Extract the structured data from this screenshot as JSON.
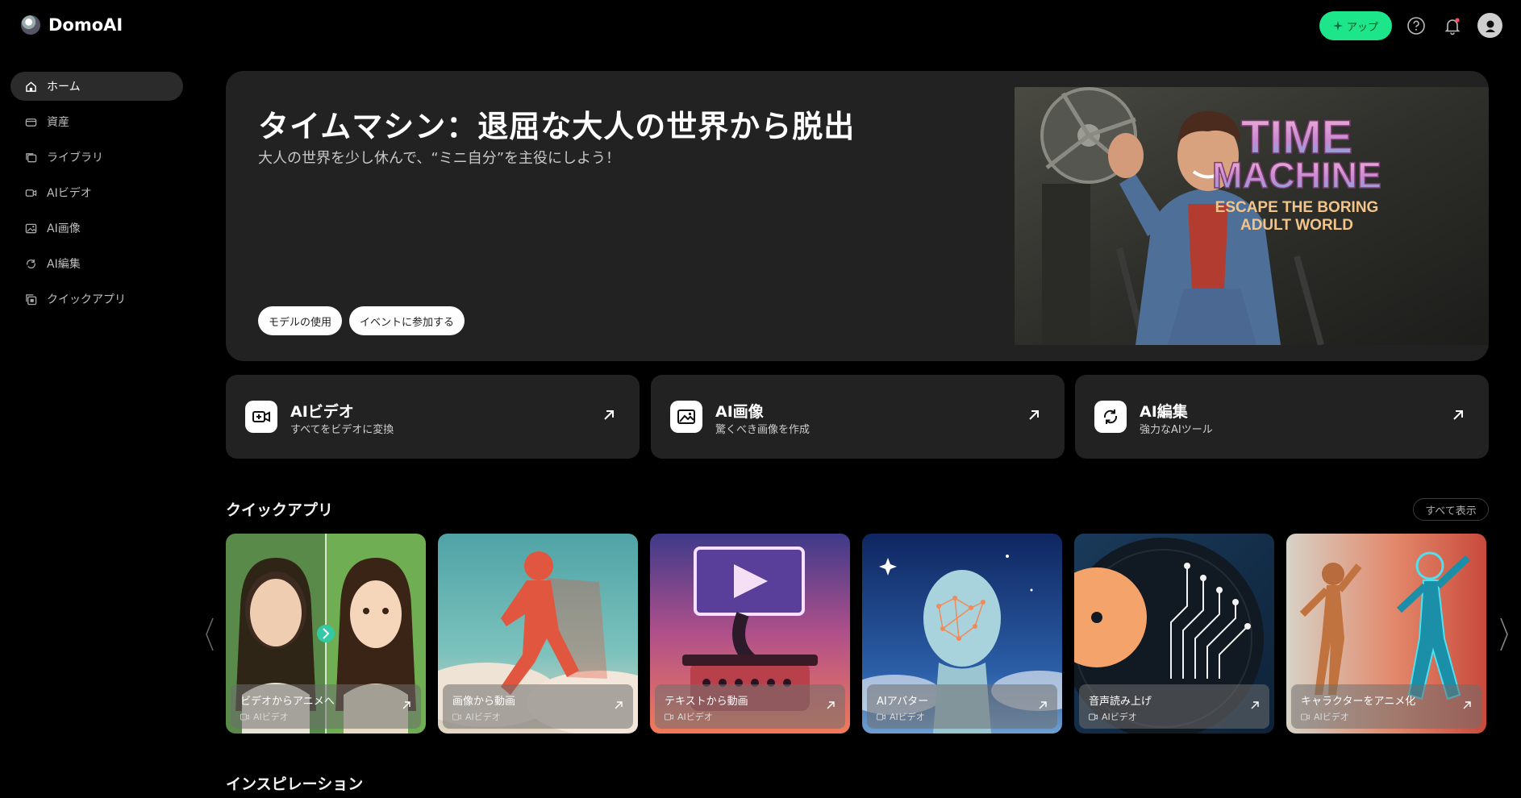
{
  "brand": {
    "name": "DomoAI"
  },
  "header": {
    "upgrade_label": "アップ"
  },
  "sidebar": {
    "items": [
      {
        "label": "ホーム",
        "icon": "home-icon",
        "active": true
      },
      {
        "label": "資産",
        "icon": "assets-icon"
      },
      {
        "label": "ライブラリ",
        "icon": "library-icon"
      },
      {
        "label": "AIビデオ",
        "icon": "video-icon"
      },
      {
        "label": "AI画像",
        "icon": "image-icon"
      },
      {
        "label": "AI編集",
        "icon": "edit-icon"
      },
      {
        "label": "クイックアプリ",
        "icon": "quick-app-icon"
      }
    ]
  },
  "hero": {
    "title": "タイムマシン：退屈な大人の世界から脱出",
    "subtitle": "大人の世界を少し休んで、“ミニ自分”を主役にしよう！",
    "buttons": [
      "モデルの使用",
      "イベントに参加する"
    ],
    "art_title_line1": "TIME",
    "art_title_line2": "MACHINE",
    "art_sub_line1": "ESCAPE THE BORING",
    "art_sub_line2": "ADULT WORLD"
  },
  "features": [
    {
      "title": "AIビデオ",
      "subtitle": "すべてをビデオに変換",
      "icon": "video-camera-icon"
    },
    {
      "title": "AI画像",
      "subtitle": "驚くべき画像を作成",
      "icon": "picture-icon"
    },
    {
      "title": "AI編集",
      "subtitle": "強力なAIツール",
      "icon": "edit-refresh-icon"
    }
  ],
  "quick_apps": {
    "title": "クイックアプリ",
    "show_all": "すべて表示",
    "items": [
      {
        "name": "ビデオからアニメへ",
        "tag": "AIビデオ"
      },
      {
        "name": "画像から動画",
        "tag": "AIビデオ"
      },
      {
        "name": "テキストから動画",
        "tag": "AIビデオ"
      },
      {
        "name": "AIアバター",
        "tag": "AIビデオ"
      },
      {
        "name": "音声読み上げ",
        "tag": "AIビデオ"
      },
      {
        "name": "キャラクターをアニメ化",
        "tag": "AIビデオ"
      }
    ]
  },
  "inspiration": {
    "title": "インスピレーション"
  },
  "colors": {
    "accent": "#1de58a",
    "background": "#000000",
    "card": "#222222"
  }
}
